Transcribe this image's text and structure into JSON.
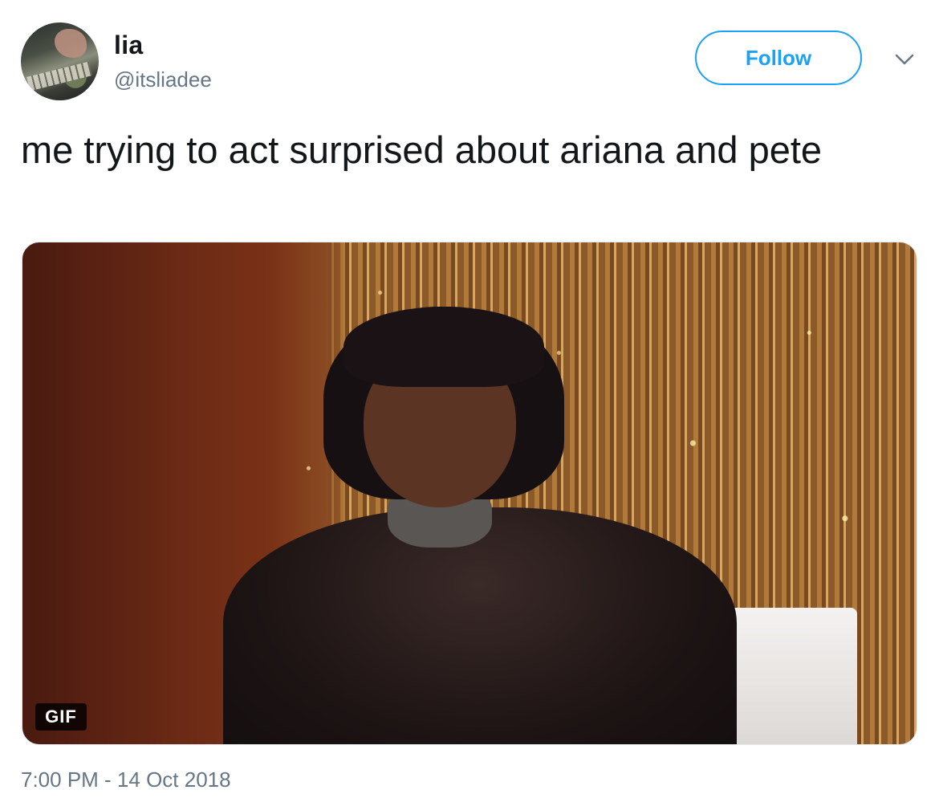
{
  "author": {
    "name": "lia",
    "handle": "@itsliadee"
  },
  "actions": {
    "follow_label": "Follow"
  },
  "tweet": {
    "text": "me trying to act surprised about ariana and pete",
    "media_badge": "GIF",
    "timestamp": "7:00 PM - 14 Oct 2018"
  },
  "colors": {
    "accent": "#1da1f2",
    "secondary_text": "#657786",
    "primary_text": "#14171a"
  },
  "icons": {
    "more": "chevron-down-icon"
  }
}
